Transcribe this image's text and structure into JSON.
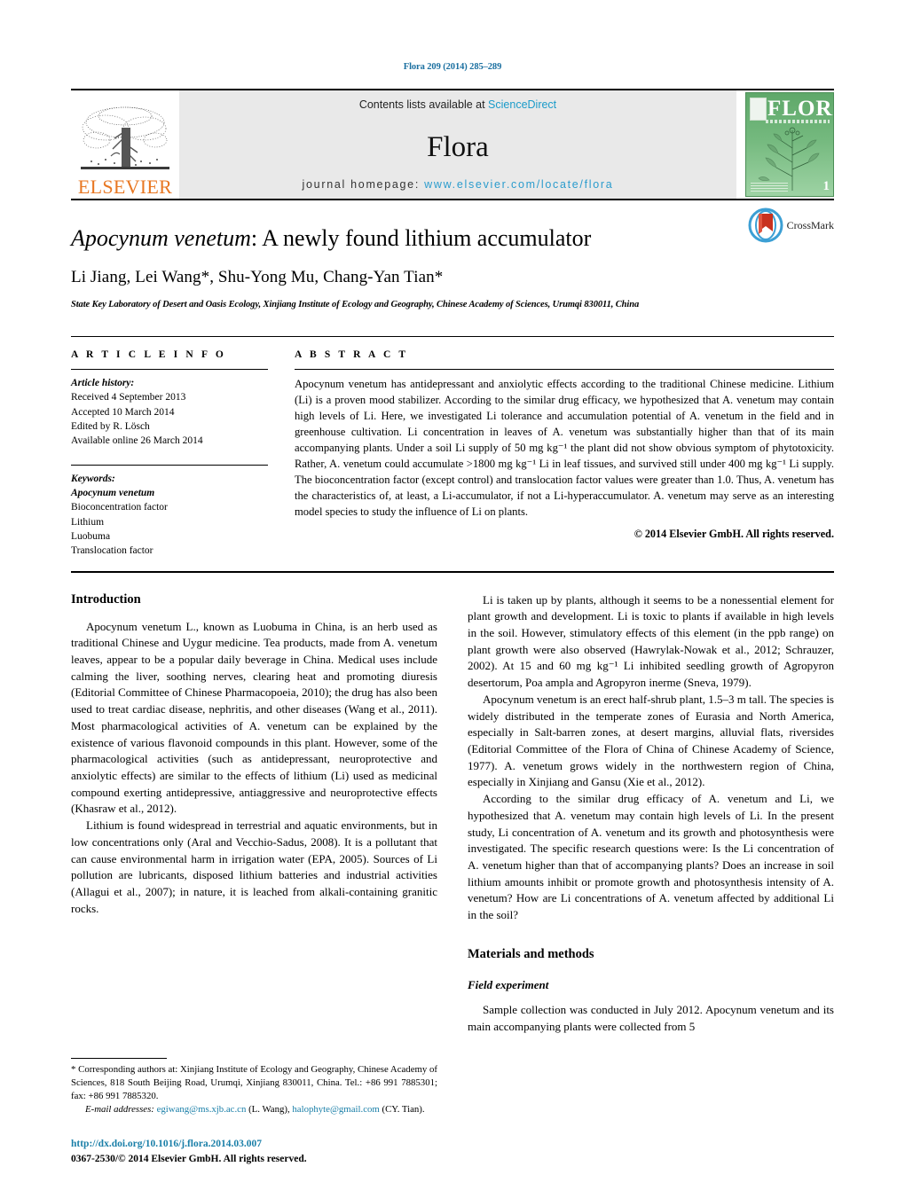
{
  "running_head": "Flora 209 (2014) 285–289",
  "masthead": {
    "publisher_logo_name": "elsevier-tree-logo",
    "publisher_wordmark": "ELSEVIER",
    "contents_prefix": "Contents lists available at ",
    "contents_link": "ScienceDirect",
    "journal_name": "Flora",
    "homepage_prefix": "journal homepage: ",
    "homepage_url": "www.elsevier.com/locate/flora",
    "cover": {
      "title": "FLORA",
      "issue_number": "1",
      "alt": "flora-journal-cover-thumbnail"
    }
  },
  "title_block": {
    "title_italic": "Apocynum venetum",
    "title_rest": ": A newly found lithium accumulator",
    "authors": "Li Jiang, Lei Wang*, Shu-Yong Mu, Chang-Yan Tian*",
    "authors_parts": [
      {
        "text": "Li Jiang, Lei Wang",
        "sup": ""
      },
      {
        "text": "*",
        "sup": "true"
      },
      {
        "text": ", Shu-Yong Mu, Chang-Yan Tian",
        "sup": ""
      },
      {
        "text": "*",
        "sup": "true"
      }
    ],
    "affiliation": "State Key Laboratory of Desert and Oasis Ecology, Xinjiang Institute of Ecology and Geography, Chinese Academy of Sciences, Urumqi 830011, China",
    "crossmark_label": "CrossMark"
  },
  "article_info": {
    "heading": "A R T I C L E    I N F O",
    "history_label": "Article history:",
    "history": [
      "Received 4 September 2013",
      "Accepted 10 March 2014",
      "Edited by R. Lösch",
      "Available online 26 March 2014"
    ],
    "keywords_label": "Keywords:",
    "keywords": [
      "Apocynum venetum",
      "Bioconcentration factor",
      "Lithium",
      "Luobuma",
      "Translocation factor"
    ]
  },
  "abstract": {
    "heading": "A B S T R A C T",
    "text": "Apocynum venetum has antidepressant and anxiolytic effects according to the traditional Chinese medicine. Lithium (Li) is a proven mood stabilizer. According to the similar drug efficacy, we hypothesized that A. venetum may contain high levels of Li. Here, we investigated Li tolerance and accumulation potential of A. venetum in the field and in greenhouse cultivation. Li concentration in leaves of A. venetum was substantially higher than that of its main accompanying plants. Under a soil Li supply of 50 mg kg⁻¹ the plant did not show obvious symptom of phytotoxicity. Rather, A. venetum could accumulate >1800 mg kg⁻¹ Li in leaf tissues, and survived still under 400 mg kg⁻¹ Li supply. The bioconcentration factor (except control) and translocation factor values were greater than 1.0. Thus, A. venetum has the characteristics of, at least, a Li-accumulator, if not a Li-hyperaccumulator. A. venetum may serve as an interesting model species to study the influence of Li on plants.",
    "copyright": "© 2014 Elsevier GmbH. All rights reserved."
  },
  "sections": {
    "introduction_heading": "Introduction",
    "materials_heading": "Materials and methods",
    "field_experiment_heading": "Field experiment"
  },
  "left_column": {
    "p1": "Apocynum venetum L., known as Luobuma in China, is an herb used as traditional Chinese and Uygur medicine. Tea products, made from A. venetum leaves, appear to be a popular daily beverage in China. Medical uses include calming the liver, soothing nerves, clearing heat and promoting diuresis (Editorial Committee of Chinese Pharmacopoeia, 2010); the drug has also been used to treat cardiac disease, nephritis, and other diseases (Wang et al., 2011). Most pharmacological activities of A. venetum can be explained by the existence of various flavonoid compounds in this plant. However, some of the pharmacological activities (such as antidepressant, neuroprotective and anxiolytic effects) are similar to the effects of lithium (Li) used as medicinal compound exerting antidepressive, antiaggressive and neuroprotective effects (Khasraw et al., 2012).",
    "p2": "Lithium is found widespread in terrestrial and aquatic environments, but in low concentrations only (Aral and Vecchio-Sadus, 2008). It is a pollutant that can cause environmental harm in irrigation water (EPA, 2005). Sources of Li pollution are lubricants, disposed lithium batteries and industrial activities (Allagui et al., 2007); in nature, it is leached from alkali-containing granitic rocks."
  },
  "right_column": {
    "p1": "Li is taken up by plants, although it seems to be a nonessential element for plant growth and development. Li is toxic to plants if available in high levels in the soil. However, stimulatory effects of this element (in the ppb range) on plant growth were also observed (Hawrylak-Nowak et al., 2012; Schrauzer, 2002). At 15 and 60 mg kg⁻¹ Li inhibited seedling growth of Agropyron desertorum, Poa ampla and Agropyron inerme (Sneva, 1979).",
    "p2": "Apocynum venetum is an erect half-shrub plant, 1.5–3 m tall. The species is widely distributed in the temperate zones of Eurasia and North America, especially in Salt-barren zones, at desert margins, alluvial flats, riversides (Editorial Committee of the Flora of China of Chinese Academy of Science, 1977). A. venetum grows widely in the northwestern region of China, especially in Xinjiang and Gansu (Xie et al., 2012).",
    "p3": "According to the similar drug efficacy of A. venetum and Li, we hypothesized that A. venetum may contain high levels of Li. In the present study, Li concentration of A. venetum and its growth and photosynthesis were investigated. The specific research questions were: Is the Li concentration of A. venetum higher than that of accompanying plants? Does an increase in soil lithium amounts inhibit or promote growth and photosynthesis intensity of A. venetum? How are Li concentrations of A. venetum affected by additional Li in the soil?",
    "p4": "Sample collection was conducted in July 2012. Apocynum venetum and its main accompanying plants were collected from 5"
  },
  "footnote": {
    "corresponding": "* Corresponding authors at: Xinjiang Institute of Ecology and Geography, Chinese Academy of Sciences, 818 South Beijing Road, Urumqi, Xinjiang 830011, China. Tel.: +86 991 7885301; fax: +86 991 7885320.",
    "email_label": "E-mail addresses:",
    "email1": "egiwang@ms.xjb.ac.cn",
    "email1_owner": "(L. Wang),",
    "email2": "halophyte@gmail.com",
    "email2_owner": "(CY. Tian)."
  },
  "doi_block": {
    "doi_url": "http://dx.doi.org/10.1016/j.flora.2014.03.007",
    "issn_line": "0367-2530/© 2014 Elsevier GmbH. All rights reserved."
  },
  "colors": {
    "link": "#1a7fa8",
    "sciencedirect": "#1a9bc9",
    "elsevier_orange": "#E87722",
    "band_bg": "#e9e9e9",
    "cover_green": "#74b97e"
  }
}
